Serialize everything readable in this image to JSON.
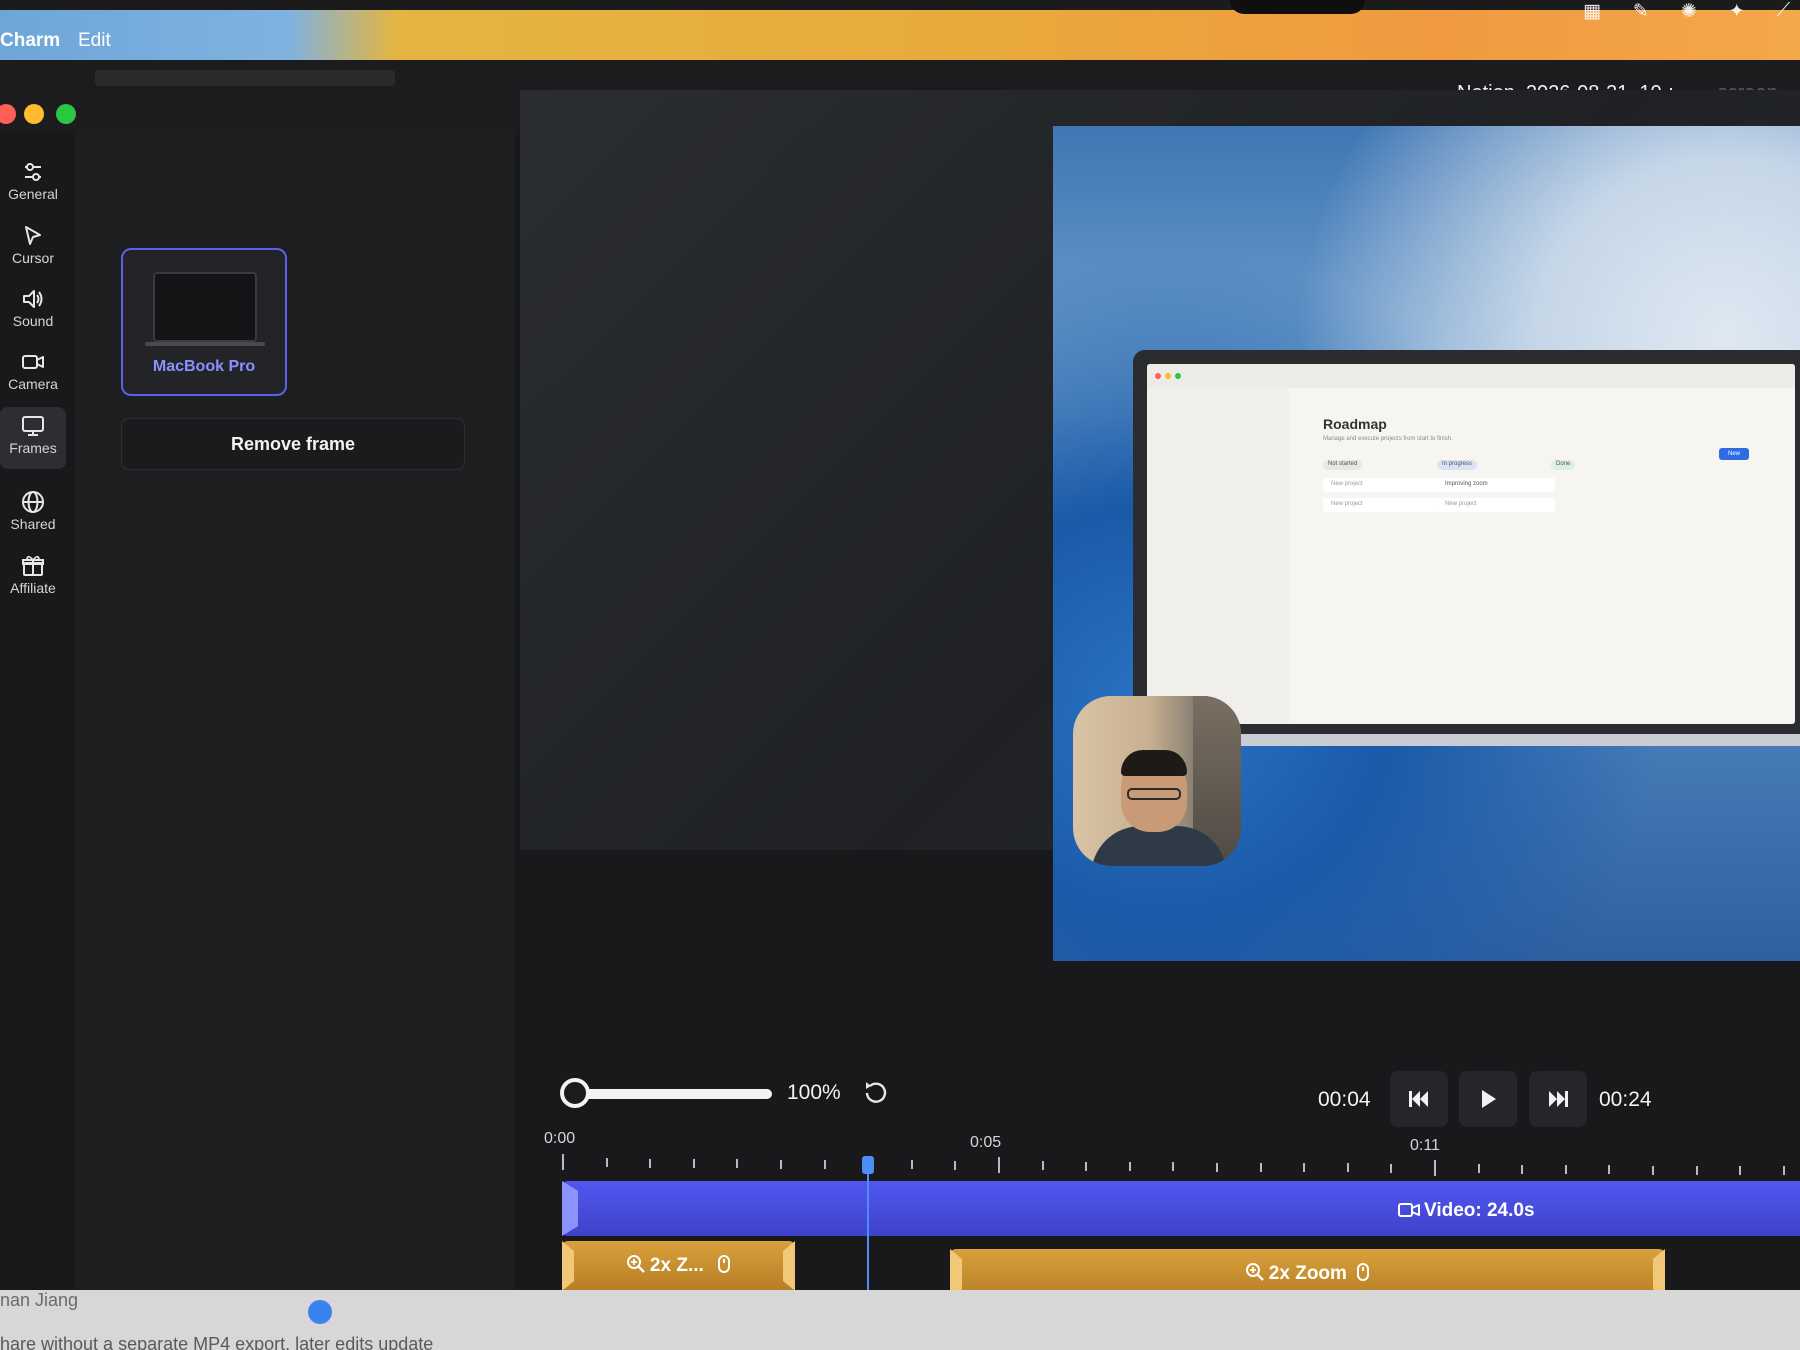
{
  "menubar": {
    "app_name": "Charm",
    "menu_edit": "Edit",
    "tray_icons": [
      "grid-icon",
      "puzzle-icon",
      "ai-icon",
      "sparkle-icon",
      "tools-icon"
    ]
  },
  "window": {
    "file_title": "Notion_2026-08-21_10-:",
    "file_ext": ".screen"
  },
  "sidebar": {
    "items": [
      {
        "label": "General",
        "icon": "sliders-icon"
      },
      {
        "label": "Cursor",
        "icon": "cursor-icon"
      },
      {
        "label": "Sound",
        "icon": "speaker-icon"
      },
      {
        "label": "Camera",
        "icon": "camera-icon"
      },
      {
        "label": "Frames",
        "icon": "monitor-icon",
        "active": true
      },
      {
        "label": "Shared",
        "icon": "globe-icon"
      },
      {
        "label": "Affiliate",
        "icon": "gift-icon"
      }
    ]
  },
  "panel": {
    "frame_name": "MacBook Pro",
    "remove_label": "Remove frame"
  },
  "preview": {
    "inner_title": "Roadmap",
    "inner_subtitle": "Manage and execute projects from start to finish.",
    "inner_new": "New",
    "chips": [
      "Not started",
      "In progress",
      "Done"
    ],
    "cards": [
      "New project",
      "Improving zoom"
    ]
  },
  "playback": {
    "zoom_percent": "100%",
    "current_time": "00:04",
    "total_time": "00:24"
  },
  "timeline": {
    "ticks": [
      "0:00",
      "0:05",
      "0:11"
    ],
    "video_label": "Video: 24.0s",
    "zoom_short": "2x Z...",
    "zoom_full": "2x Zoom"
  },
  "footer": {
    "name": "nan Jiang",
    "note": "hare without a separate MP4 export, later edits update"
  },
  "colors": {
    "accent": "#5b62e8",
    "video_track": "#4349d6",
    "zoom_track": "#c98d2e",
    "playhead": "#4d8df7"
  }
}
